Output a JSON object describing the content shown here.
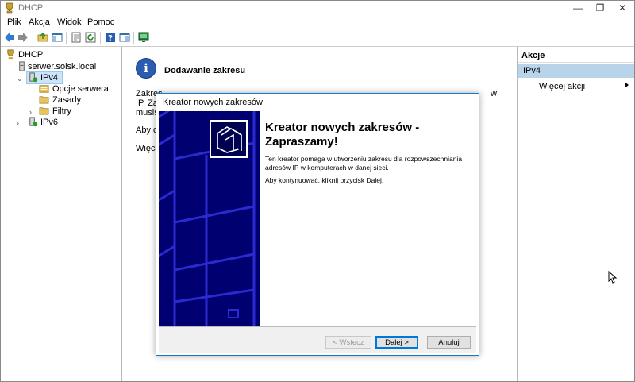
{
  "window": {
    "title": "DHCP",
    "minimize_glyph": "—",
    "maximize_glyph": "❐",
    "close_glyph": "✕"
  },
  "menu": [
    "Plik",
    "Akcja",
    "Widok",
    "Pomoc"
  ],
  "tree": {
    "root": "DHCP",
    "server": "serwer.soisk.local",
    "ipv4": "IPv4",
    "server_options": "Opcje serwera",
    "policies": "Zasady",
    "filters": "Filtry",
    "ipv6": "IPv6"
  },
  "center": {
    "heading": "Dodawanie zakresu",
    "line1": "Zakres",
    "line1_end": "w",
    "line2": "IP. Zak",
    "line3": "musisz",
    "line4": "Aby do",
    "line5": "Więcej"
  },
  "actions": {
    "header": "Akcje",
    "selected": "IPv4",
    "more": "Więcej akcji"
  },
  "dialog": {
    "title": "Kreator nowych zakresów",
    "heading": "Kreator nowych zakresów - Zapraszamy!",
    "text1": "Ten kreator pomaga w utworzeniu zakresu dla rozpowszechniania adresów IP w komputerach w danej sieci.",
    "text2": "Aby kontynuować, kliknij przycisk Dalej.",
    "back_button": "< Wstecz",
    "next_button": "Dalej >",
    "cancel_button": "Anuluj"
  },
  "colors": {
    "wizard_panel": "#000070",
    "selection": "#b9d3eb",
    "dialog_border": "#1979ca"
  }
}
